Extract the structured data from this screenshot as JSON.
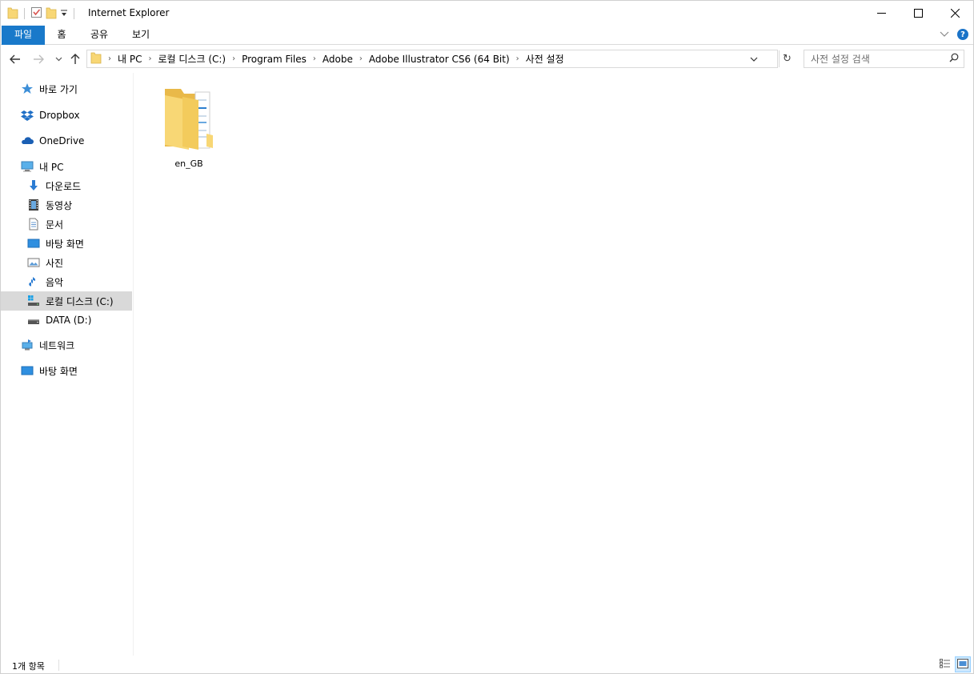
{
  "window": {
    "title": "Internet Explorer",
    "controls": {
      "minimize": "—",
      "maximize": "☐",
      "close": "✕"
    }
  },
  "ribbon": {
    "tabs": [
      {
        "label": "파일"
      },
      {
        "label": "홈"
      },
      {
        "label": "공유"
      },
      {
        "label": "보기"
      }
    ],
    "help": "?"
  },
  "address": {
    "breadcrumbs": [
      "내 PC",
      "로컬 디스크 (C:)",
      "Program Files",
      "Adobe",
      "Adobe Illustrator CS6 (64 Bit)",
      "사전 설정"
    ]
  },
  "search": {
    "placeholder": "사전 설정 검색"
  },
  "navpane": {
    "items": [
      {
        "label": "바로 가기",
        "icon": "star-icon"
      },
      {
        "label": "Dropbox",
        "icon": "dropbox-icon"
      },
      {
        "label": "OneDrive",
        "icon": "cloud-icon"
      },
      {
        "label": "내 PC",
        "icon": "computer-icon"
      },
      {
        "label": "다운로드",
        "icon": "download-arrow-icon"
      },
      {
        "label": "동영상",
        "icon": "film-icon"
      },
      {
        "label": "문서",
        "icon": "document-icon"
      },
      {
        "label": "바탕 화면",
        "icon": "desktop-icon"
      },
      {
        "label": "사진",
        "icon": "picture-icon"
      },
      {
        "label": "음악",
        "icon": "music-note-icon"
      },
      {
        "label": "로컬 디스크 (C:)",
        "icon": "windows-drive-icon",
        "selected": true
      },
      {
        "label": "DATA (D:)",
        "icon": "drive-icon"
      },
      {
        "label": "네트워크",
        "icon": "network-icon"
      },
      {
        "label": "바탕 화면",
        "icon": "desktop-icon"
      }
    ]
  },
  "content": {
    "items": [
      {
        "name": "en_GB",
        "icon": "folder-icon"
      }
    ]
  },
  "status": {
    "count_text": "1개 항목"
  },
  "colors": {
    "file_tab": "#1979ca",
    "selection": "#d9d9d9",
    "folder": "#f8d775"
  }
}
